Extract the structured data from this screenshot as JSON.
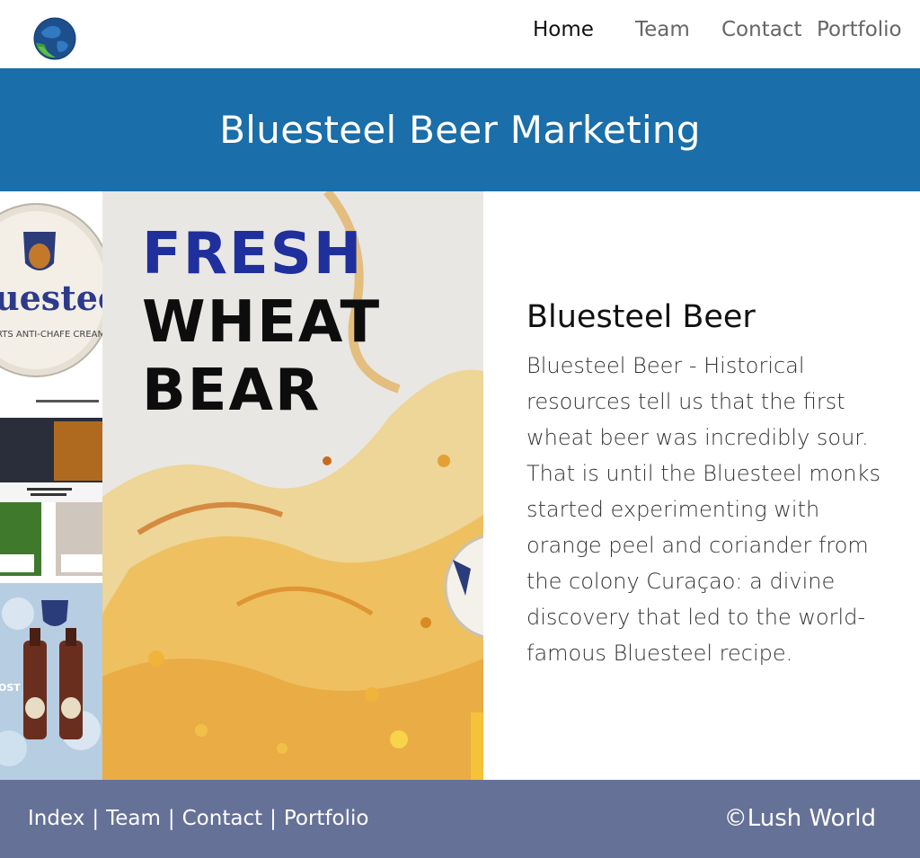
{
  "nav": {
    "items": [
      {
        "label": "Home",
        "active": true
      },
      {
        "label": "Team",
        "active": false
      },
      {
        "label": "Contact",
        "active": false
      },
      {
        "label": "Portfolio",
        "active": false
      }
    ]
  },
  "banner": {
    "title": "Bluesteel Beer Marketing",
    "background_color": "#1a6ea9"
  },
  "poster": {
    "line1": "FRESH",
    "line2": "WHEAT",
    "line3": "BEAR"
  },
  "thumbnails": {
    "label_text": "uestee",
    "label_subtext": "RTS ANTI-CHAFE CREAM",
    "bottle_left_text": "OST"
  },
  "article": {
    "heading": "Bluesteel Beer",
    "body": "Bluesteel Beer - Historical resources tell us that the first wheat beer was incredibly sour. That is until the Bluesteel monks started experimenting with orange peel and coriander from the colony Curaçao: a divine discovery that led to the world-famous Bluesteel recipe."
  },
  "footer": {
    "links": [
      "Index",
      "Team",
      "Contact",
      "Portfolio"
    ],
    "separator": "|",
    "copyright": "©Lush World",
    "background_color": "#667197"
  }
}
